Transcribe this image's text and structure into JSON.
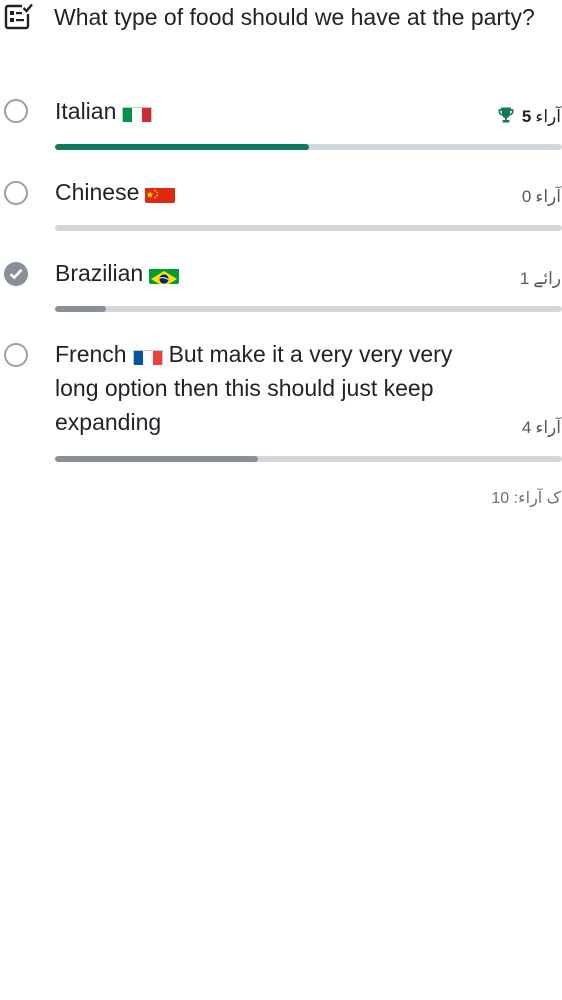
{
  "question": "What type of food should we have at the party?",
  "options": [
    {
      "label": "Italian",
      "flag_icon": "italy-flag-icon",
      "votes_text": "5",
      "votes_suffix": "آراء",
      "fraction": 0.5,
      "winner": true,
      "selected": false
    },
    {
      "label": "Chinese",
      "flag_icon": "china-flag-icon",
      "votes_text": "0",
      "votes_suffix": "آراء",
      "fraction": 0,
      "winner": false,
      "selected": false
    },
    {
      "label": "Brazilian",
      "flag_icon": "brazil-flag-icon",
      "votes_text": "1",
      "votes_suffix": "رائے",
      "fraction": 0.1,
      "winner": false,
      "selected": true
    },
    {
      "label_before_flag": "French",
      "label_after_flag": "But make it a very very very long option then this should just keep expanding",
      "flag_icon": "france-flag-icon",
      "votes_text": "4",
      "votes_suffix": "آراء",
      "fraction": 0.4,
      "winner": false,
      "selected": false
    }
  ],
  "total_text": "ک آراء: 10",
  "colors": {
    "winner_bar": "#0f7a5e",
    "bar": "#8a9099",
    "track": "#d1d7db"
  }
}
